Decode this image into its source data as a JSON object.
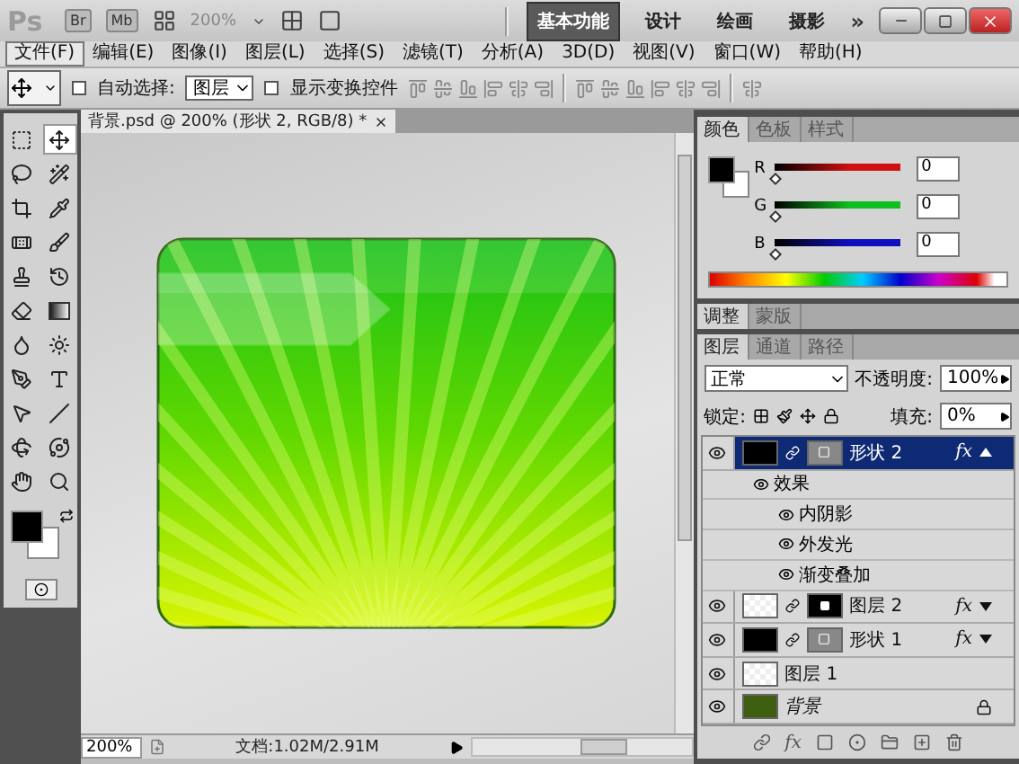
{
  "title_bar": {
    "logo": "Ps",
    "apps": [
      "Br",
      "Mb"
    ],
    "zoom": "200%",
    "workspaces": [
      {
        "label": "基本功能",
        "selected": true
      },
      {
        "label": "设计",
        "selected": false
      },
      {
        "label": "绘画",
        "selected": false
      },
      {
        "label": "摄影",
        "selected": false
      }
    ],
    "more": "»"
  },
  "menu": [
    {
      "label": "文件(F)",
      "selected": true
    },
    {
      "label": "编辑(E)",
      "selected": false
    },
    {
      "label": "图像(I)",
      "selected": false
    },
    {
      "label": "图层(L)",
      "selected": false
    },
    {
      "label": "选择(S)",
      "selected": false
    },
    {
      "label": "滤镜(T)",
      "selected": false
    },
    {
      "label": "分析(A)",
      "selected": false
    },
    {
      "label": "3D(D)",
      "selected": false
    },
    {
      "label": "视图(V)",
      "selected": false
    },
    {
      "label": "窗口(W)",
      "selected": false
    },
    {
      "label": "帮助(H)",
      "selected": false
    }
  ],
  "options_bar": {
    "auto_select": {
      "label": "自动选择:",
      "checked": false
    },
    "target": "图层",
    "show_transform": {
      "label": "显示变换控件",
      "checked": false
    }
  },
  "tools": [
    {
      "selected": false
    },
    {
      "selected": true
    },
    {
      "selected": false
    },
    {
      "selected": false
    },
    {
      "selected": false
    },
    {
      "selected": false
    },
    {
      "selected": false
    },
    {
      "selected": false
    },
    {
      "selected": false
    },
    {
      "selected": false
    },
    {
      "selected": false
    },
    {
      "selected": false
    },
    {
      "selected": false
    },
    {
      "selected": false
    },
    {
      "selected": false
    },
    {
      "selected": false
    },
    {
      "selected": false
    },
    {
      "selected": false
    },
    {
      "selected": false
    },
    {
      "selected": false
    },
    {
      "selected": false
    },
    {
      "selected": false
    }
  ],
  "document": {
    "tab": "背景.psd @ 200% (形状 2, RGB/8) *",
    "zoom": "200%",
    "info": "文档:1.02M/2.91M"
  },
  "color_panel": {
    "tabs": [
      {
        "label": "颜色",
        "selected": true
      },
      {
        "label": "色板",
        "selected": false
      },
      {
        "label": "样式",
        "selected": false
      }
    ],
    "channels": [
      {
        "name": "R",
        "value": "0",
        "level": 0,
        "color": "#d01010"
      },
      {
        "name": "G",
        "value": "0",
        "level": 0,
        "color": "#10c020"
      },
      {
        "name": "B",
        "value": "0",
        "level": 0,
        "color": "#1010c0"
      }
    ]
  },
  "adjustments_panel": {
    "tabs": [
      {
        "label": "调整",
        "selected": true
      },
      {
        "label": "蒙版",
        "selected": false
      }
    ]
  },
  "layers_panel": {
    "tabs": [
      {
        "label": "图层",
        "selected": true
      },
      {
        "label": "通道",
        "selected": false
      },
      {
        "label": "路径",
        "selected": false
      }
    ],
    "footer_fx": "fx",
    "blend_mode": "正常",
    "opacity_label": "不透明度:",
    "opacity": "100%",
    "lock_label": "锁定:",
    "fill_label": "填充:",
    "fill": "0%",
    "layers": [
      {
        "name": "形状 2",
        "kind": "shape",
        "selected": true,
        "fx": "fx",
        "expanded": true,
        "locked": false,
        "children": [
          {
            "name": "效果",
            "children": [
              {
                "name": "内阴影"
              },
              {
                "name": "外发光"
              },
              {
                "name": "渐变叠加"
              }
            ]
          }
        ]
      },
      {
        "name": "图层 2",
        "kind": "masked",
        "selected": false,
        "fx": "fx",
        "expanded": false,
        "locked": false
      },
      {
        "name": "形状 1",
        "kind": "shape",
        "selected": false,
        "fx": "fx",
        "expanded": false,
        "locked": false
      },
      {
        "name": "图层 1",
        "kind": "pixel",
        "selected": false,
        "expanded": false,
        "locked": false
      },
      {
        "name": "背景",
        "kind": "background",
        "selected": false,
        "expanded": false,
        "locked": true
      }
    ]
  }
}
